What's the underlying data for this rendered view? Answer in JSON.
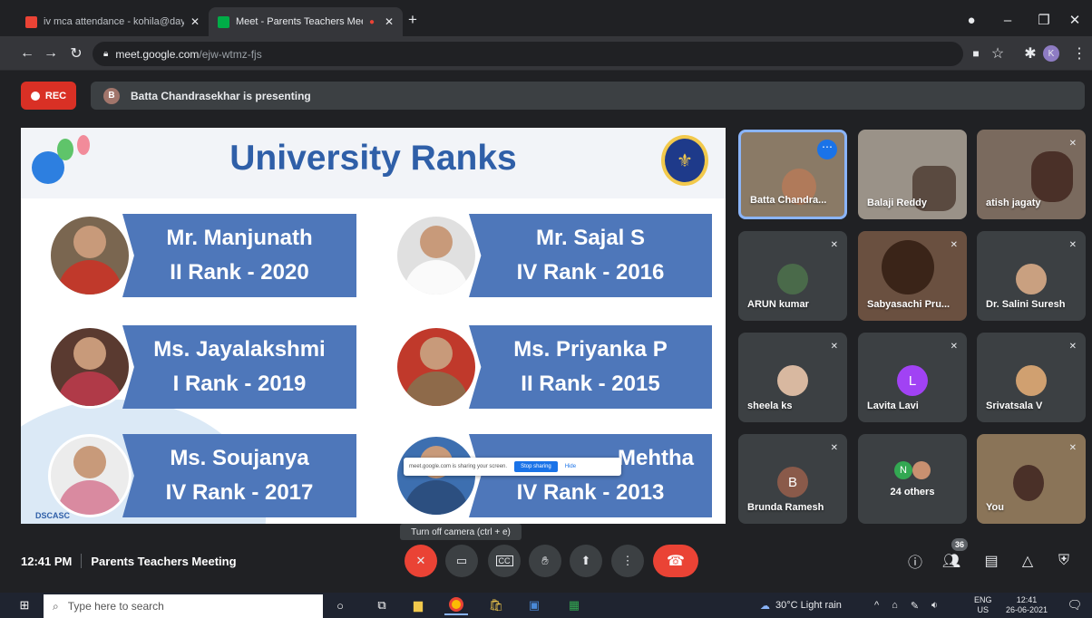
{
  "browser": {
    "tabs": [
      {
        "title": "iv mca attendance - kohila@daya"
      },
      {
        "title": "Meet - Parents Teachers Mee"
      }
    ],
    "new_tab": "+",
    "url_host": "meet.google.com",
    "url_path": "/ejw-wtmz-fjs",
    "profile_initial": "K"
  },
  "meet": {
    "rec_label": "REC",
    "presenter_initial": "B",
    "presenting_text": "Batta Chandrasekhar is presenting",
    "time": "12:41 PM",
    "meeting_name": "Parents Teachers Meeting",
    "tooltip": "Turn off camera (ctrl + e)",
    "participant_count": "36",
    "share_notice": "meet.google.com is sharing your screen.",
    "stop_sharing": "Stop sharing",
    "hide": "Hide"
  },
  "slide": {
    "title": "University Ranks",
    "watermark": "DSCASC",
    "cards": [
      {
        "name": "Mr. Manjunath",
        "rank": "II Rank - 2020"
      },
      {
        "name": "Mr. Sajal S",
        "rank": "IV Rank - 2016"
      },
      {
        "name": "Ms. Jayalakshmi",
        "rank": "I Rank - 2019"
      },
      {
        "name": "Ms. Priyanka P",
        "rank": "II Rank - 2015"
      },
      {
        "name": "Ms. Soujanya",
        "rank": "IV Rank - 2017"
      },
      {
        "name": "Mehtha",
        "rank": "IV Rank - 2013"
      }
    ]
  },
  "participants": [
    {
      "name": "Batta Chandra..."
    },
    {
      "name": "Balaji Reddy"
    },
    {
      "name": "atish jagaty"
    },
    {
      "name": "ARUN kumar"
    },
    {
      "name": "Sabyasachi Pru..."
    },
    {
      "name": "Dr. Salini Suresh"
    },
    {
      "name": "sheela ks"
    },
    {
      "name": "Lavita Lavi",
      "initial": "L"
    },
    {
      "name": "Srivatsala V"
    },
    {
      "name": "Brunda Ramesh",
      "initial": "B"
    },
    {
      "name": "24 others",
      "initial": "N"
    },
    {
      "name": "You"
    }
  ],
  "taskbar": {
    "search_placeholder": "Type here to search",
    "weather": "30°C Light rain",
    "lang_top": "ENG",
    "lang_bottom": "US",
    "clock_time": "12:41",
    "clock_date": "26-06-2021"
  },
  "colors": {
    "accent": "#2f5fa8",
    "card": "#4e77ba",
    "rec": "#d93025"
  }
}
